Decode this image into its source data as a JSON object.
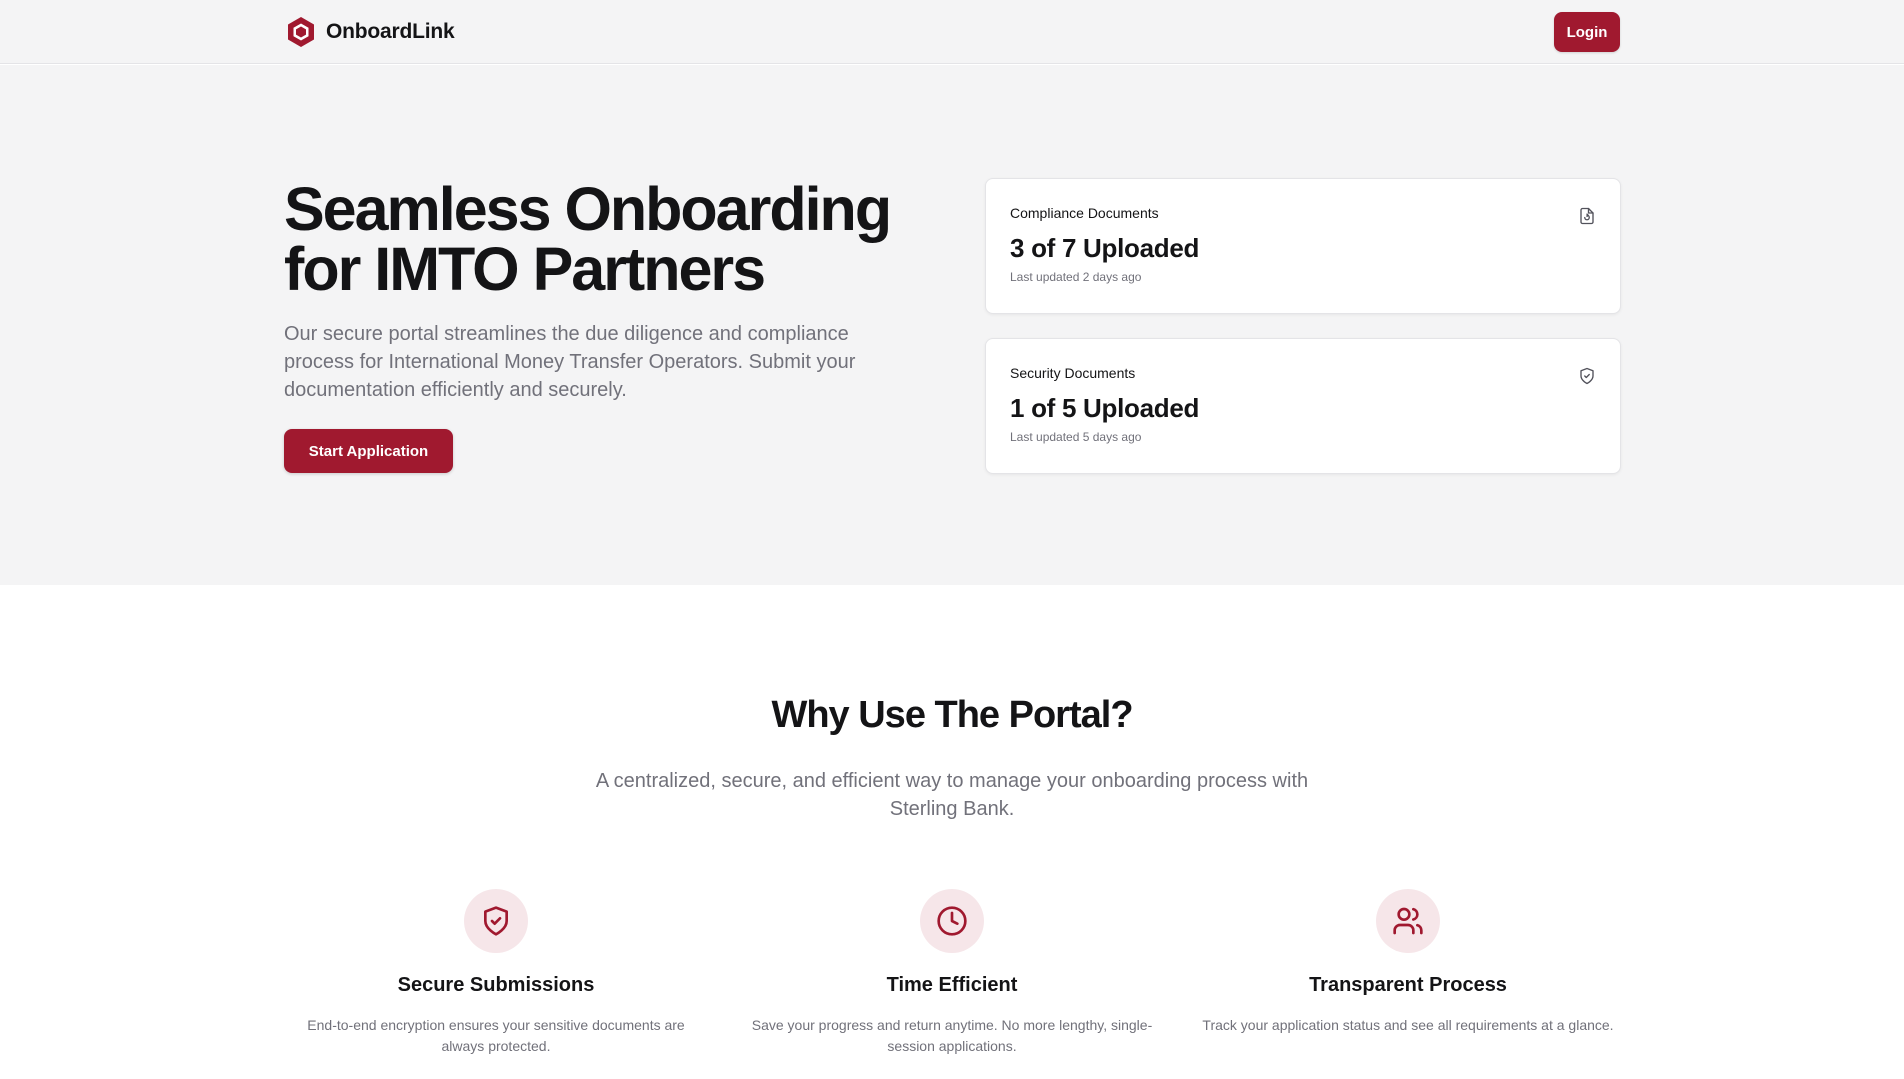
{
  "colors": {
    "brand": "#a0192f",
    "hero_background": "#f4f4f5",
    "text_primary": "#141416",
    "text_muted": "#71717a",
    "icon_circle_background": "#f6e6e9"
  },
  "navbar": {
    "brand_icon": "hexagon-logo-icon",
    "brand_name": "OnboardLink",
    "login_label": "Login"
  },
  "hero": {
    "title": "Seamless Onboarding for IMTO Partners",
    "subtitle": "Our secure portal streamlines the due diligence and compliance process for International Money Transfer Operators. Submit your documentation efficiently and securely.",
    "cta_label": "Start Application"
  },
  "document_cards": [
    {
      "label": "Compliance Documents",
      "value": "3 of 7 Uploaded",
      "meta": "Last updated 2 days ago",
      "icon": "file-refresh-icon"
    },
    {
      "label": "Security Documents",
      "value": "1 of 5 Uploaded",
      "meta": "Last updated 5 days ago",
      "icon": "shield-check-icon"
    }
  ],
  "why_section": {
    "title": "Why Use The Portal?",
    "subtitle": "A centralized, secure, and efficient way to manage your onboarding process with Sterling Bank.",
    "features": [
      {
        "title": "Secure Submissions",
        "description": "End-to-end encryption ensures your sensitive documents are always protected.",
        "icon": "shield-check-icon"
      },
      {
        "title": "Time Efficient",
        "description": "Save your progress and return anytime. No more lengthy, single-session applications.",
        "icon": "clock-icon"
      },
      {
        "title": "Transparent Process",
        "description": "Track your application status and see all requirements at a glance.",
        "icon": "users-icon"
      }
    ]
  }
}
